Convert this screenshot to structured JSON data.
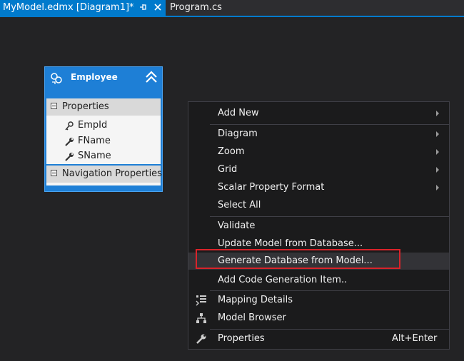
{
  "tabs": {
    "active": {
      "label": "MyModel.edmx [Diagram1]*",
      "pin_icon": "pin-icon",
      "close_icon": "close-icon"
    },
    "inactive": {
      "label": "Program.cs"
    }
  },
  "entity": {
    "title": "Employee",
    "icon": "entity-icon",
    "collapse_icon": "double-chevron-up-icon",
    "properties_header": "Properties",
    "properties": [
      {
        "name": "EmpId",
        "icon": "key-icon"
      },
      {
        "name": "FName",
        "icon": "wrench-icon"
      },
      {
        "name": "SName",
        "icon": "wrench-icon"
      }
    ],
    "navigation_header": "Navigation Properties"
  },
  "context_menu": {
    "items": [
      {
        "label": "Add New",
        "submenu": true
      },
      {
        "label": "Diagram",
        "submenu": true
      },
      {
        "label": "Zoom",
        "submenu": true
      },
      {
        "label": "Grid",
        "submenu": true
      },
      {
        "label": "Scalar Property Format",
        "submenu": true
      },
      {
        "label": "Select All",
        "submenu": false
      },
      {
        "label": "Validate",
        "submenu": false
      },
      {
        "label": "Update Model from Database...",
        "submenu": false
      },
      {
        "label": "Generate Database from Model...",
        "submenu": false,
        "highlighted": true
      },
      {
        "label": "Add Code Generation Item..",
        "submenu": false
      },
      {
        "label": "Mapping Details",
        "icon": "mapping-details-icon"
      },
      {
        "label": "Model Browser",
        "icon": "model-browser-icon"
      },
      {
        "label": "Properties",
        "icon": "wrench-icon",
        "shortcut": "Alt+Enter"
      }
    ]
  },
  "colors": {
    "accent": "#007acc",
    "entity_blue": "#1e7fd6",
    "menu_bg": "#1b1b1c",
    "canvas_bg": "#232325",
    "highlight_red": "#d9232a"
  }
}
